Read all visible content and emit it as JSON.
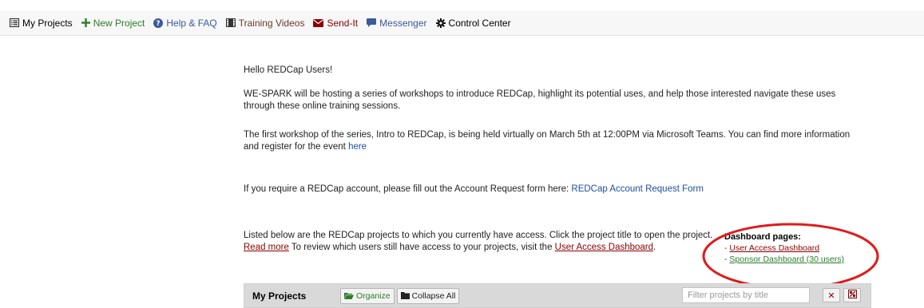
{
  "nav": {
    "my_projects": "My Projects",
    "new_project": "New Project",
    "help_faq": "Help & FAQ",
    "training_videos": "Training Videos",
    "send_it": "Send-It",
    "messenger": "Messenger",
    "control_center": "Control Center"
  },
  "announcement": {
    "greeting": "Hello REDCap Users!",
    "para1": "WE-SPARK will be hosting a series of workshops to introduce REDCap, highlight its potential uses, and help those interested navigate these uses through these online training sessions.",
    "para2_text": "The first workshop of the series, Intro to REDCap, is being held virtually on March 5th at 12:00PM via Microsoft Teams. You can find more information and register for the event ",
    "para2_link": "here",
    "account_text": "If you require a REDCap account, please fill out the Account Request form here: ",
    "account_link": "REDCap Account Request Form"
  },
  "listing": {
    "text_before": "Listed below are the REDCap projects to which you currently have access. Click the project title to open the project. ",
    "read_more": "Read more",
    "text_middle": " To review which users still have access to your projects, visit the ",
    "dashboard_link": "User Access Dashboard",
    "text_after": "."
  },
  "dashboard": {
    "title": "Dashboard pages:",
    "items": [
      {
        "prefix": "- ",
        "label": "User Access Dashboard"
      },
      {
        "prefix": "- ",
        "label": "Sponsor Dashboard (30 users)"
      }
    ]
  },
  "projects_bar": {
    "title": "My Projects",
    "organize": "Organize",
    "collapse_all": "Collapse All",
    "filter_placeholder": "Filter projects by title"
  },
  "colors": {
    "annotation_ellipse": "#e01b1b",
    "link_blue": "#1c4e9c",
    "link_red": "#8b0000",
    "link_green": "#2a7d2a"
  },
  "icons": [
    "list-icon",
    "plus-icon",
    "question-circle-icon",
    "film-icon",
    "envelope-icon",
    "chat-icon",
    "gear-icon",
    "folder-open-icon",
    "folder-icon",
    "times-icon",
    "clear-icon"
  ]
}
